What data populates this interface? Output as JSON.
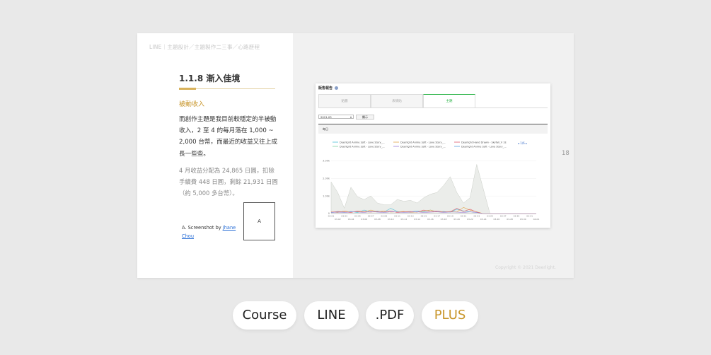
{
  "slide": {
    "breadcrumb": "LINE｜主題設計／主題製作二三事／心路歷程",
    "section_title": "1.1.8 漸入佳境",
    "subtitle": "被動收入",
    "paragraph1": "而創作主題是我目前較穩定的半被動收入，2 至 4 的每月落在 1,000 ~ 2,000 台幣，而最近的收益又往上成長一些些。",
    "paragraph2": "4 月收益分配為 24,865 日圓，扣除手續費 448 日圓，剩餘 21,931 日圓（約 5,000 多台幣）。",
    "credit_prefix": "A. Screenshot by ",
    "credit_link": "Jhane Chou",
    "thumb_label": "A",
    "page_number": "18",
    "copyright": "Copyright © 2021 Deerlight."
  },
  "report": {
    "title": "販售報告",
    "tabs": [
      "貼圖",
      "表情貼",
      "主題"
    ],
    "active_tab": 2,
    "period": "2021.03",
    "show_button": "顯示",
    "section_label": "每日",
    "pager": "1/6",
    "colors": {
      "tab_active": "#2fb54a"
    }
  },
  "chart_data": {
    "type": "line",
    "legend": [
      {
        "name": "Deerlight Anime Soft - Love Story_...",
        "color": "#4fc0d8"
      },
      {
        "name": "Deerlight Anime Soft - Love Story_...",
        "color": "#e2a54a"
      },
      {
        "name": "Deerlight Hand Drawn - Skyfall_V 1E",
        "color": "#e05c6e"
      },
      {
        "name": "Deerlight Anime Soft - Love Story_...",
        "color": "#7fd3a0"
      },
      {
        "name": "Deerlight Anime Soft - Love Story_...",
        "color": "#9a7ad8"
      },
      {
        "name": "Deerlight Anime Soft - Love Story_...",
        "color": "#5a9ee0"
      }
    ],
    "yticks": [
      "0",
      "1.00k",
      "2.00k",
      "3.00k"
    ],
    "ylim": [
      0,
      3300
    ],
    "x_top": [
      "03-01",
      "03-03",
      "03-05",
      "03-07",
      "03-09",
      "03-11",
      "03-13",
      "03-15",
      "03-17",
      "03-19",
      "03-21",
      "03-23",
      "03-25",
      "03-27",
      "03-29",
      "03-31"
    ],
    "x_bottom": [
      "03-02",
      "03-04",
      "03-06",
      "03-08",
      "03-10",
      "03-12",
      "03-14",
      "03-16",
      "03-18",
      "03-20",
      "03-22",
      "03-24",
      "03-26",
      "03-28",
      "03-30",
      "04-01"
    ],
    "total": [
      1800,
      1200,
      300,
      1500,
      950,
      800,
      1000,
      600,
      500,
      500,
      800,
      700,
      750,
      600,
      900,
      1100,
      1200,
      1600,
      2100,
      1200,
      600,
      900,
      2800,
      1400,
      0,
      0,
      0,
      0,
      0,
      0,
      0,
      0
    ],
    "series": [
      {
        "color": "#4fc0d8",
        "values": [
          50,
          100,
          80,
          120,
          60,
          200,
          90,
          150,
          80,
          300,
          120,
          80,
          100,
          150,
          90,
          200,
          100,
          120,
          80,
          250,
          150,
          100,
          60,
          0,
          0,
          0,
          0,
          0,
          0,
          0,
          0,
          0
        ]
      },
      {
        "color": "#e2a54a",
        "values": [
          100,
          60,
          150,
          80,
          120,
          90,
          200,
          100,
          150,
          80,
          100,
          120,
          60,
          90,
          150,
          200,
          100,
          80,
          120,
          90,
          350,
          200,
          100,
          0,
          0,
          0,
          0,
          0,
          0,
          0,
          0,
          0
        ]
      },
      {
        "color": "#e05c6e",
        "values": [
          80,
          120,
          100,
          60,
          150,
          100,
          80,
          120,
          90,
          150,
          60,
          100,
          120,
          80,
          200,
          100,
          150,
          90,
          100,
          300,
          120,
          250,
          80,
          0,
          0,
          0,
          0,
          0,
          0,
          0,
          0,
          0
        ]
      },
      {
        "color": "#9a7ad8",
        "values": [
          60,
          80,
          50,
          100,
          90,
          60,
          120,
          80,
          60,
          100,
          90,
          60,
          80,
          100,
          60,
          80,
          100,
          60,
          90,
          80,
          60,
          100,
          60,
          0,
          0,
          0,
          0,
          0,
          0,
          0,
          0,
          0
        ]
      }
    ]
  },
  "buttons": [
    {
      "label": "Course",
      "color": "#222222"
    },
    {
      "label": "LINE",
      "color": "#222222"
    },
    {
      "label": ".PDF",
      "color": "#222222"
    },
    {
      "label": "PLUS",
      "color": "#c8962b"
    }
  ]
}
